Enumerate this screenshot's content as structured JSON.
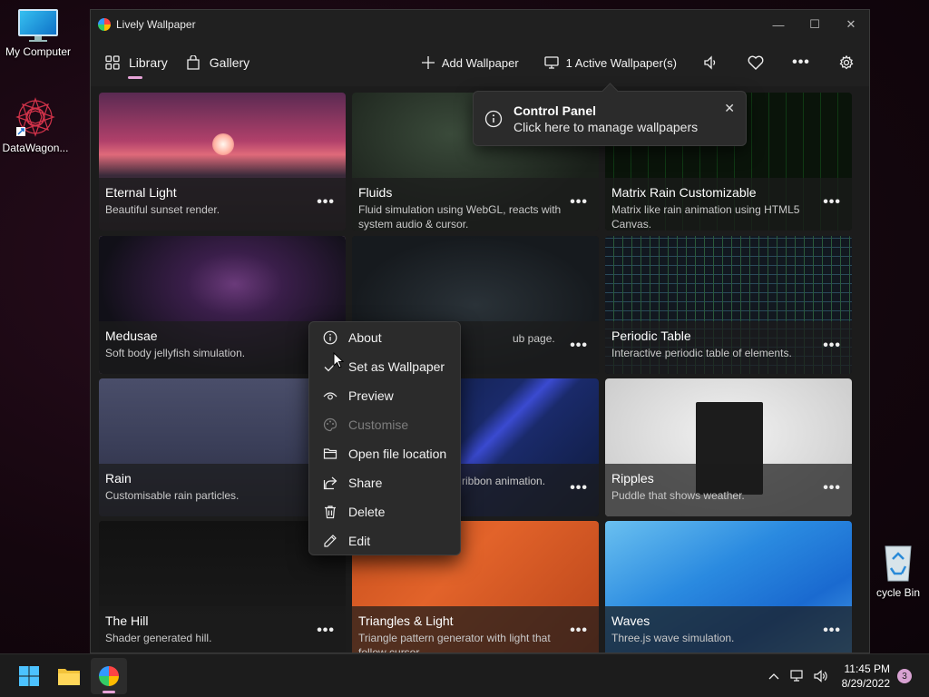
{
  "desktop": {
    "icons": [
      {
        "label": "My Computer"
      },
      {
        "label": "DataWagon..."
      },
      {
        "label": "cycle Bin"
      }
    ]
  },
  "window": {
    "title": "Lively Wallpaper",
    "nav": {
      "library": "Library",
      "gallery": "Gallery",
      "add_wallpaper": "Add Wallpaper",
      "active_wallpapers": "1 Active Wallpaper(s)"
    }
  },
  "tip": {
    "title": "Control Panel",
    "subtitle": "Click here to manage wallpapers"
  },
  "wallpapers": [
    {
      "title": "Eternal Light",
      "desc": "Beautiful sunset render."
    },
    {
      "title": "Fluids",
      "desc": "Fluid simulation using WebGL, reacts with system audio & cursor."
    },
    {
      "title": "Matrix Rain Customizable",
      "desc": "Matrix like rain animation using HTML5 Canvas."
    },
    {
      "title": "Medusae",
      "desc": "Soft body jellyfish simulation."
    },
    {
      "title": "",
      "desc": "ub page."
    },
    {
      "title": "Periodic Table",
      "desc": "Interactive periodic table of elements."
    },
    {
      "title": "Rain",
      "desc": "Customisable rain particles."
    },
    {
      "title": "",
      "desc": "ribbon animation."
    },
    {
      "title": "Ripples",
      "desc": "Puddle that shows weather."
    },
    {
      "title": "The Hill",
      "desc": "Shader generated hill."
    },
    {
      "title": "Triangles & Light",
      "desc": "Triangle pattern generator with light that follow cursor."
    },
    {
      "title": "Waves",
      "desc": "Three.js wave simulation."
    }
  ],
  "context_menu": {
    "items": [
      {
        "label": "About",
        "enabled": true
      },
      {
        "label": "Set as Wallpaper",
        "enabled": true
      },
      {
        "label": "Preview",
        "enabled": true
      },
      {
        "label": "Customise",
        "enabled": false
      },
      {
        "label": "Open file location",
        "enabled": true
      },
      {
        "label": "Share",
        "enabled": true
      },
      {
        "label": "Delete",
        "enabled": true
      },
      {
        "label": "Edit",
        "enabled": true
      }
    ]
  },
  "taskbar": {
    "time": "11:45 PM",
    "date": "8/29/2022",
    "notification_count": "3"
  },
  "colors": {
    "accent": "#e7a4d8",
    "window_bg": "#1c1c1c",
    "menu_bg": "#2b2b2b"
  }
}
